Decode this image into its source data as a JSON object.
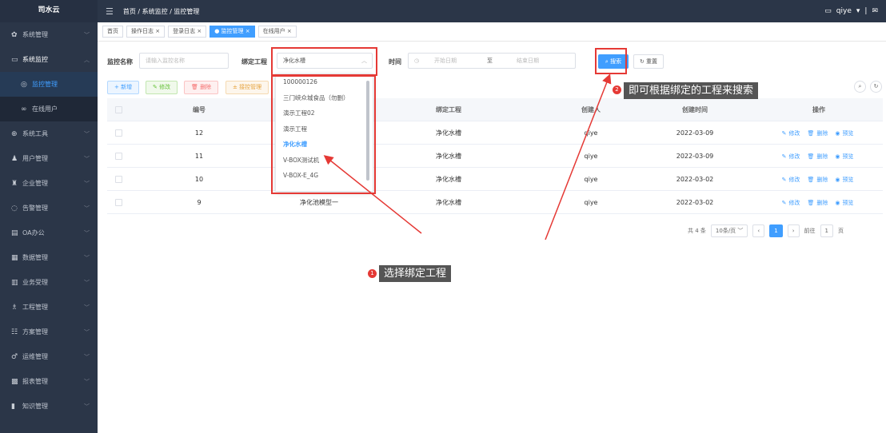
{
  "app": {
    "name": "司水云"
  },
  "topbar": {
    "hamburger_icon": "menu-fold-icon",
    "breadcrumb": "首页 / 系统监控 / 监控管理",
    "user": "qiye",
    "divider": "|"
  },
  "sidebar": {
    "items": [
      {
        "label": "系统管理",
        "icon": "gear-icon"
      },
      {
        "label": "系统监控",
        "icon": "monitor-icon"
      },
      {
        "label": "系统工具",
        "icon": "tool-icon"
      },
      {
        "label": "用户管理",
        "icon": "user-icon"
      },
      {
        "label": "企业管理",
        "icon": "enterprise-icon"
      },
      {
        "label": "告警管理",
        "icon": "alarm-icon"
      },
      {
        "label": "OA办公",
        "icon": "document-icon"
      },
      {
        "label": "数据管理",
        "icon": "data-icon"
      },
      {
        "label": "业务受理",
        "icon": "business-icon"
      },
      {
        "label": "工程管理",
        "icon": "engineering-icon"
      },
      {
        "label": "方案管理",
        "icon": "plan-icon"
      },
      {
        "label": "运维管理",
        "icon": "maintenance-icon"
      },
      {
        "label": "报表管理",
        "icon": "report-icon"
      },
      {
        "label": "知识管理",
        "icon": "book-icon"
      }
    ],
    "sub": [
      {
        "label": "监控管理"
      },
      {
        "label": "在线用户"
      }
    ]
  },
  "tags": [
    {
      "label": "首页"
    },
    {
      "label": "操作日志"
    },
    {
      "label": "登录日志"
    },
    {
      "label": "监控管理"
    },
    {
      "label": "在线用户"
    }
  ],
  "filter": {
    "name_label": "监控名称",
    "name_placeholder": "请输入监控名称",
    "project_label": "绑定工程",
    "project_value": "净化水槽",
    "time_label": "时间",
    "start_placeholder": "开始日期",
    "to": "至",
    "end_placeholder": "结束日期",
    "search": "搜索",
    "reset": "重置"
  },
  "toolbar": {
    "add": "+ 新增",
    "edit": "修改",
    "delete": "删除",
    "other": "接控管理"
  },
  "dropdown": {
    "options": [
      "100000126",
      "三门峡众城食品（勿删）",
      "演示工程02",
      "演示工程",
      "净化水槽",
      "V-BOX测试机",
      "V-BOX-E_4G"
    ],
    "selected": "净化水槽"
  },
  "table": {
    "headers": [
      "编号",
      "",
      "绑定工程",
      "创建人",
      "创建时间",
      "操作"
    ],
    "rows": [
      {
        "id": "12",
        "name": "",
        "project": "净化水槽",
        "creator": "qiye",
        "date": "2022-03-09"
      },
      {
        "id": "11",
        "name": "",
        "project": "净化水槽",
        "creator": "qiye",
        "date": "2022-03-09"
      },
      {
        "id": "10",
        "name": "",
        "project": "净化水槽",
        "creator": "qiye",
        "date": "2022-03-02"
      },
      {
        "id": "9",
        "name": "净化池模型一",
        "project": "净化水槽",
        "creator": "qiye",
        "date": "2022-03-02"
      }
    ],
    "ops": {
      "edit": "修改",
      "delete": "删除",
      "preview": "预览"
    }
  },
  "pager": {
    "total": "共 4 条",
    "size": "10条/页",
    "page": "1",
    "goto": "前往",
    "goto_value": "1",
    "unit": "页"
  },
  "annotations": {
    "step1_num": "1",
    "step1": "选择绑定工程",
    "step2_num": "2",
    "step2": "即可根据绑定的工程来搜索"
  },
  "colors": {
    "primary": "#409eff",
    "sidebar": "#2b3648",
    "annotation": "#e53935"
  }
}
